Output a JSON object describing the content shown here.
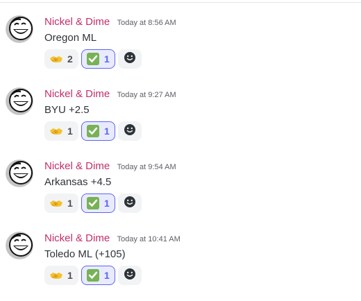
{
  "messages": [
    {
      "username": "Nickel & Dime",
      "timestamp": "Today at 8:56 AM",
      "content": "Oregon ML",
      "reactions": [
        {
          "emoji": "handshake-emoji",
          "count": "2",
          "selected": false
        },
        {
          "emoji": "check-mark-emoji",
          "count": "1",
          "selected": true
        }
      ]
    },
    {
      "username": "Nickel & Dime",
      "timestamp": "Today at 9:27 AM",
      "content": "BYU +2.5",
      "reactions": [
        {
          "emoji": "handshake-emoji",
          "count": "1",
          "selected": false
        },
        {
          "emoji": "check-mark-emoji",
          "count": "1",
          "selected": true
        }
      ]
    },
    {
      "username": "Nickel & Dime",
      "timestamp": "Today at 9:54 AM",
      "content": "Arkansas +4.5",
      "reactions": [
        {
          "emoji": "handshake-emoji",
          "count": "1",
          "selected": false
        },
        {
          "emoji": "check-mark-emoji",
          "count": "1",
          "selected": true
        }
      ]
    },
    {
      "username": "Nickel & Dime",
      "timestamp": "Today at 10:41 AM",
      "content": "Toledo ML (+105)",
      "reactions": [
        {
          "emoji": "handshake-emoji",
          "count": "1",
          "selected": false
        },
        {
          "emoji": "check-mark-emoji",
          "count": "1",
          "selected": true
        }
      ]
    }
  ],
  "add_reaction_icon": "smiley-add-reaction-icon",
  "colors": {
    "username": "#c22e6b",
    "timestamp": "#5c5e66",
    "text": "#2e3338",
    "reaction_bg": "#f2f3f5",
    "reaction_selected_bg": "#e9ebfd",
    "reaction_selected_border": "#5865f2",
    "check_green": "#77b255"
  }
}
